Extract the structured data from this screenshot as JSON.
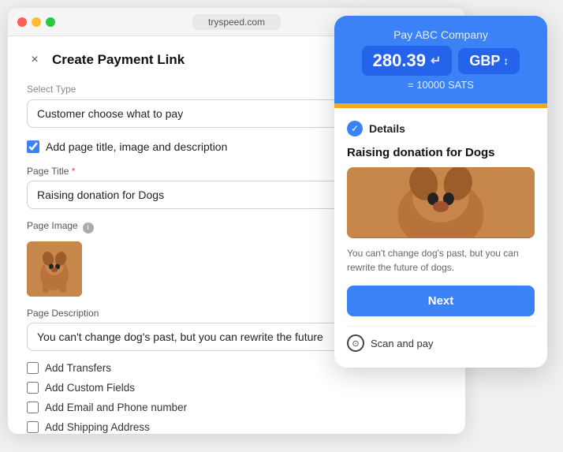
{
  "browser": {
    "url": "tryspeed.com",
    "dots": [
      "red",
      "yellow",
      "green"
    ]
  },
  "modal": {
    "title": "Create Payment Link",
    "close_label": "×",
    "select_type_label": "Select Type",
    "select_type_value": "Customer choose what to pay",
    "select_type_placeholder": "Customer choose what to pay",
    "checkbox_page_info": {
      "label": "Add page title, image and description",
      "checked": true
    },
    "page_title": {
      "label": "Page Title",
      "required": true,
      "value": "Raising donation for Dogs"
    },
    "page_image": {
      "label": "Page Image"
    },
    "page_description": {
      "label": "Page Description",
      "value": "You can't change dog's past, but you can rewrite the future"
    },
    "options": [
      {
        "label": "Add Transfers",
        "checked": false
      },
      {
        "label": "Add Custom Fields",
        "checked": false
      },
      {
        "label": "Add Email and Phone number",
        "checked": false
      },
      {
        "label": "Add Shipping Address",
        "checked": false
      }
    ]
  },
  "preview": {
    "payment_tooltip": {
      "company": "Pay ABC Company",
      "amount": "280.39",
      "currency": "GBP",
      "sats": "= 10000 SATS"
    },
    "card": {
      "details_label": "Details",
      "title": "Raising donation for Dogs",
      "description": "You can't change dog's past, but you can rewrite the future of dogs.",
      "next_button": "Next",
      "scan_pay": "Scan and pay"
    }
  }
}
